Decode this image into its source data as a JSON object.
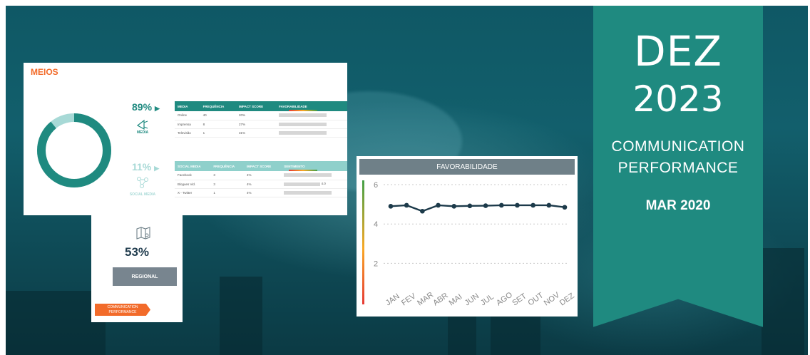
{
  "banner": {
    "month": "DEZ",
    "year": "2023",
    "line1": "COMMUNICATION",
    "line2": "PERFORMANCE",
    "period": "MAR 2020"
  },
  "meios": {
    "title": "MEIOS",
    "media_pct": "89%",
    "media_label": "MEDIA",
    "social_pct": "11%",
    "social_label": "SOCIAL MEDIA",
    "donut_value": 0.89,
    "media_table": {
      "headers": [
        "MEDIA",
        "FREQUÊNCIA",
        "IMPACT SCORE",
        "FAVORABILIDADE"
      ],
      "rows": [
        {
          "name": "Online",
          "freq": "40",
          "impact": "20%",
          "fav": 0.96
        },
        {
          "name": "Imprensa",
          "freq": "8",
          "impact": "27%",
          "fav": 0.96
        },
        {
          "name": "Televisão",
          "freq": "1",
          "impact": "31%",
          "fav": 0.96
        }
      ]
    },
    "social_table": {
      "headers": [
        "SOCIAL MEDIA",
        "FREQUÊNCIA",
        "IMPACT SCORE",
        "SENTIMENTO"
      ],
      "rows": [
        {
          "name": "Facebook",
          "freq": "3",
          "impact": "4%",
          "fav": 0.96
        },
        {
          "name": "Blogues Vid.",
          "freq": "3",
          "impact": "4%",
          "fav": 0.73,
          "val": "4.0"
        },
        {
          "name": "X - Twitter",
          "freq": "1",
          "impact": "4%",
          "fav": 0.96
        }
      ]
    }
  },
  "regional": {
    "pct": "53%",
    "button": "REGIONAL",
    "tag_line1": "COMMUNICATION",
    "tag_line2": "PERFORMANCE"
  },
  "chart_data": {
    "type": "line",
    "title": "FAVORABILIDADE",
    "categories": [
      "JAN",
      "FEV",
      "MAR",
      "ABR",
      "MAI",
      "JUN",
      "JUL",
      "AGO",
      "SET",
      "OUT",
      "NOV",
      "DEZ"
    ],
    "series": [
      {
        "values": [
          4.9,
          4.95,
          4.65,
          4.95,
          4.9,
          4.92,
          4.93,
          4.95,
          4.95,
          4.95,
          4.95,
          4.85
        ]
      }
    ],
    "ylim": [
      1,
      6
    ],
    "yticks": [
      2,
      4,
      6
    ],
    "grid": true
  },
  "colors": {
    "teal": "#1f8a80",
    "light_teal": "#a7d9d6",
    "orange": "#f26b2a",
    "dark_line": "#1c3a4a"
  }
}
